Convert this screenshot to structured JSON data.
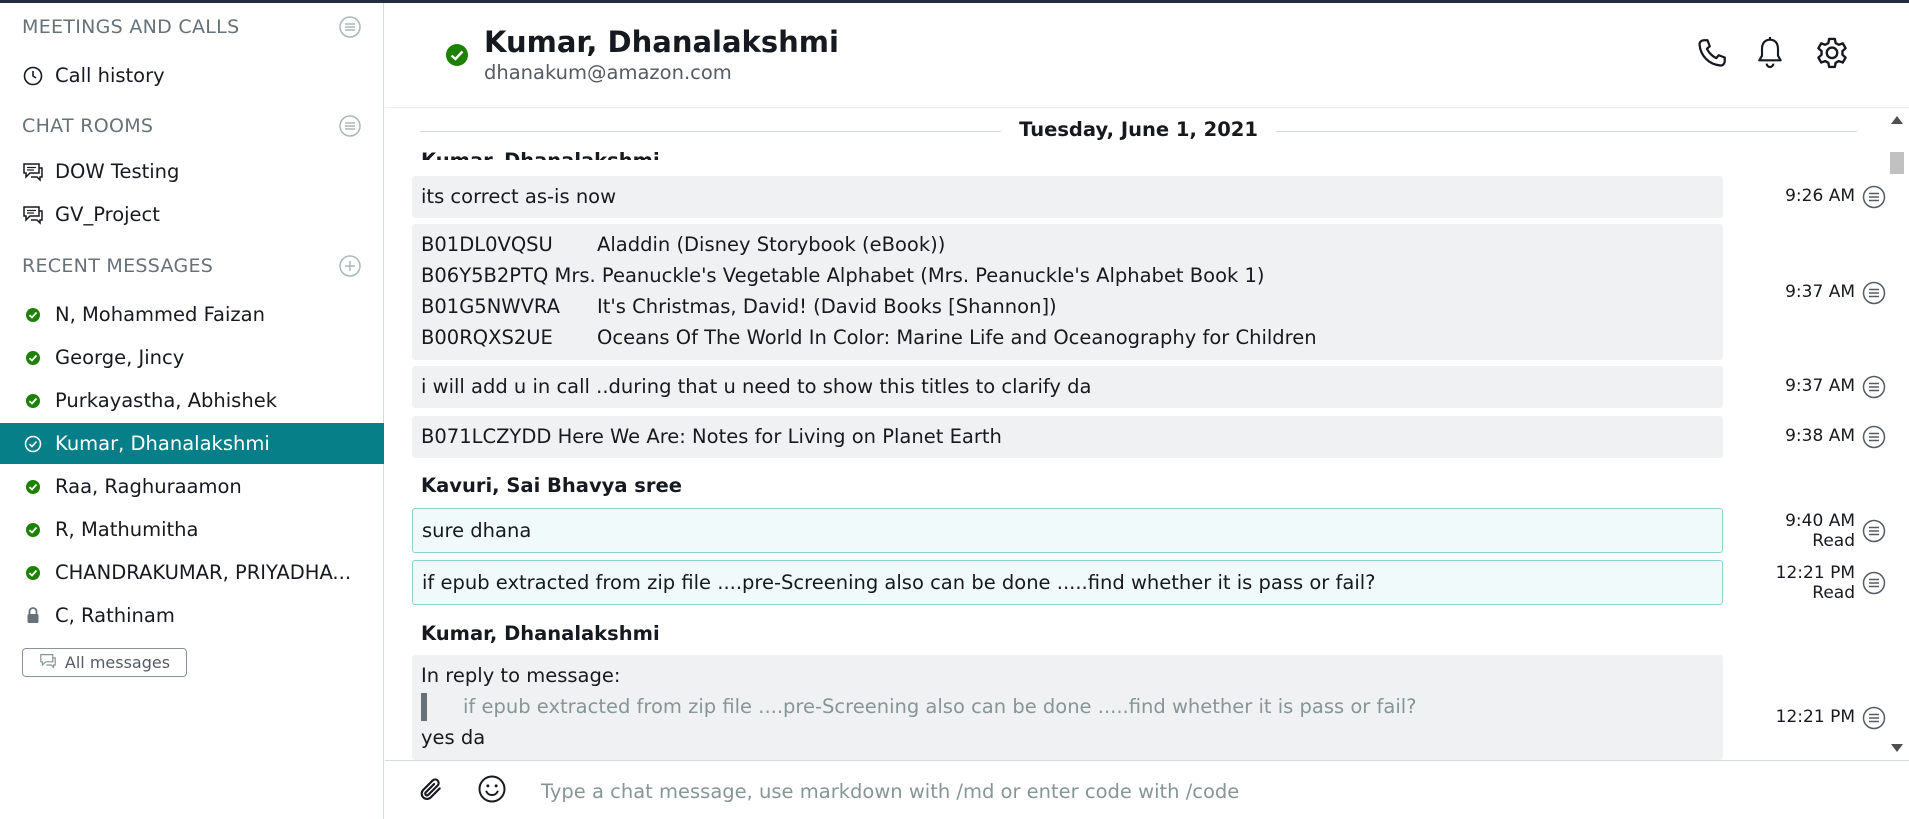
{
  "sidebar": {
    "meetings_header": "MEETINGS AND CALLS",
    "call_history": "Call history",
    "chat_rooms_header": "CHAT ROOMS",
    "rooms": [
      "DOW Testing",
      "GV_Project"
    ],
    "recent_header": "RECENT MESSAGES",
    "recent": [
      {
        "label": "N, Mohammed Faizan",
        "status": "online"
      },
      {
        "label": "George, Jincy",
        "status": "online"
      },
      {
        "label": "Purkayastha, Abhishek",
        "status": "online"
      },
      {
        "label": "Kumar, Dhanalakshmi",
        "status": "online",
        "active": true
      },
      {
        "label": "Raa, Raghuraamon",
        "status": "online"
      },
      {
        "label": "R, Mathumitha",
        "status": "online"
      },
      {
        "label": "CHANDRAKUMAR, PRIYADHA...",
        "status": "online"
      },
      {
        "label": "C, Rathinam",
        "status": "locked"
      }
    ],
    "all_messages": "All messages"
  },
  "header": {
    "name": "Kumar, Dhanalakshmi",
    "email": "dhanakum@amazon.com"
  },
  "conversation": {
    "date": "Tuesday, June 1, 2021",
    "cut_sender": "Kumar, Dhanalakshmi",
    "m1": {
      "text": "its correct as-is now",
      "time": "9:26 AM"
    },
    "m2": {
      "rows": [
        {
          "code": "B01DL0VQSU",
          "title": "Aladdin (Disney Storybook (eBook))"
        },
        {
          "code": "B06Y5B2PTQ",
          "title": "Mrs. Peanuckle's Vegetable Alphabet (Mrs. Peanuckle's Alphabet Book 1)"
        },
        {
          "code": "B01G5NWVRA",
          "title": "It's Christmas, David! (David Books [Shannon])"
        },
        {
          "code": "B00RQXS2UE",
          "title": "Oceans Of The World In Color: Marine Life and Oceanography for Children"
        }
      ],
      "time": "9:37 AM"
    },
    "m3": {
      "text": "i will add u in call ..during that u need to show this titles to clarify da",
      "time": "9:37 AM"
    },
    "m4": {
      "text": "B071LCZYDD Here We Are: Notes for Living on Planet Earth",
      "time": "9:38 AM"
    },
    "sender2": "Kavuri, Sai Bhavya sree",
    "m5": {
      "text": "sure dhana",
      "time": "9:40 AM",
      "status": "Read"
    },
    "m6": {
      "text": "if epub extracted from zip file ....pre-Screening also can be done .....find whether it is pass or fail?",
      "time": "12:21 PM",
      "status": "Read"
    },
    "sender3": "Kumar, Dhanalakshmi",
    "m7": {
      "reply_label": "In reply to message:",
      "quote": "if epub extracted from zip file ....pre-Screening also can be done .....find whether it is pass or fail?",
      "text": "yes da",
      "time": "12:21 PM"
    }
  },
  "composer": {
    "placeholder": "Type a chat message, use markdown with /md or enter code with /code"
  },
  "colors": {
    "accent": "#067f88",
    "online": "#1d8102",
    "muted": "#687078"
  }
}
